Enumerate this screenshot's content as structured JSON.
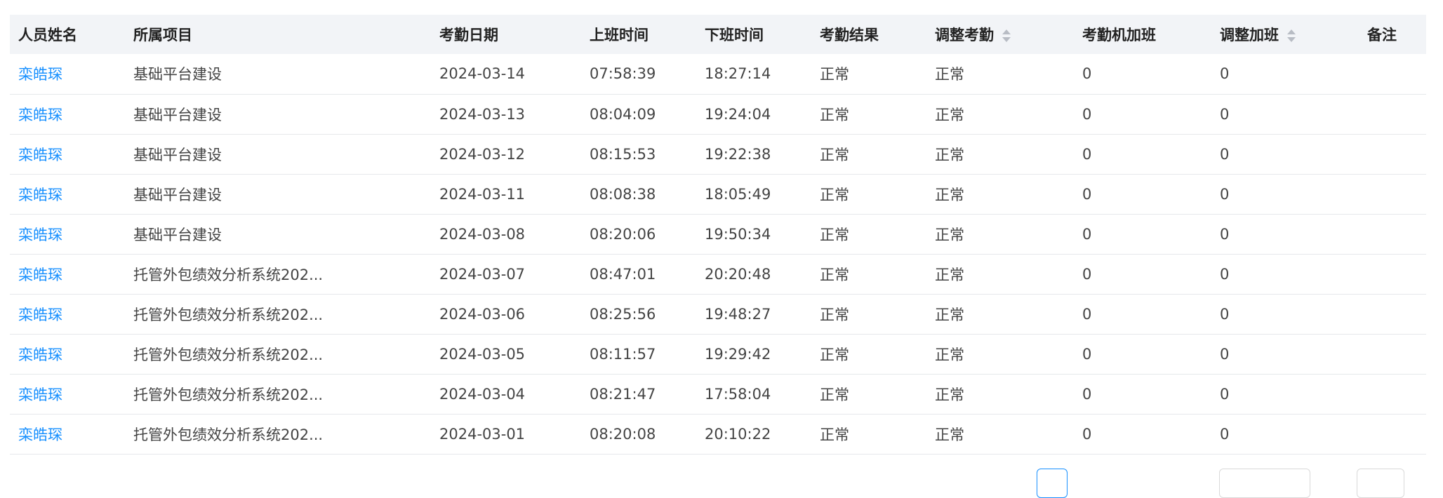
{
  "table": {
    "columns": [
      {
        "label": "人员姓名",
        "sortable": false
      },
      {
        "label": "所属项目",
        "sortable": false
      },
      {
        "label": "考勤日期",
        "sortable": false
      },
      {
        "label": "上班时间",
        "sortable": false
      },
      {
        "label": "下班时间",
        "sortable": false
      },
      {
        "label": "考勤结果",
        "sortable": false
      },
      {
        "label": "调整考勤",
        "sortable": true
      },
      {
        "label": "考勤机加班",
        "sortable": false
      },
      {
        "label": "调整加班",
        "sortable": true
      },
      {
        "label": "备注",
        "sortable": false
      }
    ],
    "rows": [
      {
        "name": "栾皓琛",
        "project": "基础平台建设",
        "date": "2024-03-14",
        "in": "07:58:39",
        "out": "18:27:14",
        "result": "正常",
        "adjusted": "正常",
        "machine_ot": "0",
        "adjusted_ot": "0",
        "note": ""
      },
      {
        "name": "栾皓琛",
        "project": "基础平台建设",
        "date": "2024-03-13",
        "in": "08:04:09",
        "out": "19:24:04",
        "result": "正常",
        "adjusted": "正常",
        "machine_ot": "0",
        "adjusted_ot": "0",
        "note": ""
      },
      {
        "name": "栾皓琛",
        "project": "基础平台建设",
        "date": "2024-03-12",
        "in": "08:15:53",
        "out": "19:22:38",
        "result": "正常",
        "adjusted": "正常",
        "machine_ot": "0",
        "adjusted_ot": "0",
        "note": ""
      },
      {
        "name": "栾皓琛",
        "project": "基础平台建设",
        "date": "2024-03-11",
        "in": "08:08:38",
        "out": "18:05:49",
        "result": "正常",
        "adjusted": "正常",
        "machine_ot": "0",
        "adjusted_ot": "0",
        "note": ""
      },
      {
        "name": "栾皓琛",
        "project": "基础平台建设",
        "date": "2024-03-08",
        "in": "08:20:06",
        "out": "19:50:34",
        "result": "正常",
        "adjusted": "正常",
        "machine_ot": "0",
        "adjusted_ot": "0",
        "note": ""
      },
      {
        "name": "栾皓琛",
        "project": "托管外包绩效分析系统202...",
        "date": "2024-03-07",
        "in": "08:47:01",
        "out": "20:20:48",
        "result": "正常",
        "adjusted": "正常",
        "machine_ot": "0",
        "adjusted_ot": "0",
        "note": ""
      },
      {
        "name": "栾皓琛",
        "project": "托管外包绩效分析系统202...",
        "date": "2024-03-06",
        "in": "08:25:56",
        "out": "19:48:27",
        "result": "正常",
        "adjusted": "正常",
        "machine_ot": "0",
        "adjusted_ot": "0",
        "note": ""
      },
      {
        "name": "栾皓琛",
        "project": "托管外包绩效分析系统202...",
        "date": "2024-03-05",
        "in": "08:11:57",
        "out": "19:29:42",
        "result": "正常",
        "adjusted": "正常",
        "machine_ot": "0",
        "adjusted_ot": "0",
        "note": ""
      },
      {
        "name": "栾皓琛",
        "project": "托管外包绩效分析系统202...",
        "date": "2024-03-04",
        "in": "08:21:47",
        "out": "17:58:04",
        "result": "正常",
        "adjusted": "正常",
        "machine_ot": "0",
        "adjusted_ot": "0",
        "note": ""
      },
      {
        "name": "栾皓琛",
        "project": "托管外包绩效分析系统202...",
        "date": "2024-03-01",
        "in": "08:20:08",
        "out": "20:10:22",
        "result": "正常",
        "adjusted": "正常",
        "machine_ot": "0",
        "adjusted_ot": "0",
        "note": ""
      }
    ]
  },
  "colors": {
    "link": "#1890ff",
    "header_bg": "#f2f4f7",
    "border": "#e6e8eb",
    "pager_active": "#1890ff"
  }
}
